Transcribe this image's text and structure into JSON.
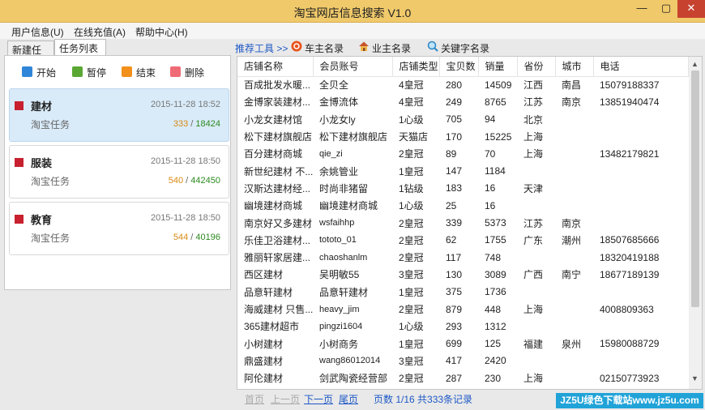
{
  "window": {
    "title": "淘宝网店信息搜索 V1.0",
    "min": "—",
    "max": "▢",
    "close": "✕"
  },
  "menu": [
    "用户信息(U)",
    "在线充值(A)",
    "帮助中心(H)"
  ],
  "left_tabs": [
    "新建任务",
    "任务列表"
  ],
  "actions": [
    {
      "label": "开始",
      "color": "#2f86d9"
    },
    {
      "label": "暂停",
      "color": "#5aa833"
    },
    {
      "label": "结束",
      "color": "#f2901b"
    },
    {
      "label": "删除",
      "color": "#ef6b75"
    }
  ],
  "tasks": [
    {
      "name": "建材",
      "date": "2015-11-28 18:52",
      "type": "淘宝任务",
      "done": "333",
      "total": "18424"
    },
    {
      "name": "服装",
      "date": "2015-11-28 18:50",
      "type": "淘宝任务",
      "done": "540",
      "total": "442450"
    },
    {
      "name": "教育",
      "date": "2015-11-28 18:50",
      "type": "淘宝任务",
      "done": "544",
      "total": "40196"
    }
  ],
  "toolbar": {
    "recommend": "推荐工具 >>",
    "car": "车主名录",
    "business": "业主名录",
    "keyword": "关键字名录"
  },
  "columns": [
    "店铺名称",
    "会员账号",
    "店铺类型",
    "宝贝数",
    "销量",
    "省份",
    "城市",
    "电话"
  ],
  "rows": [
    [
      "百成批发水暖...",
      "全贝全",
      "4皇冠",
      "280",
      "14509",
      "江西",
      "南昌",
      "15079188337"
    ],
    [
      "金博家装建材...",
      "金博流体",
      "4皇冠",
      "249",
      "8765",
      "江苏",
      "南京",
      "13851940474"
    ],
    [
      "小龙女建材馆",
      "小龙女ly",
      "1心级",
      "705",
      "94",
      "北京",
      "",
      ""
    ],
    [
      "松下建材旗舰店",
      "松下建材旗舰店",
      "天猫店",
      "170",
      "15225",
      "上海",
      "",
      ""
    ],
    [
      "百分建材商城",
      "qie_zi",
      "2皇冠",
      "89",
      "70",
      "上海",
      "",
      "13482179821"
    ],
    [
      "新世纪建材 不...",
      "余姚管业",
      "1皇冠",
      "147",
      "1184",
      "",
      "",
      ""
    ],
    [
      "汉斯达建材经...",
      "时尚非猪留",
      "1钻级",
      "183",
      "16",
      "天津",
      "",
      ""
    ],
    [
      "幽境建材商城",
      "幽境建材商城",
      "1心级",
      "25",
      "16",
      "",
      "",
      ""
    ],
    [
      "南京好又多建材",
      "wsfaihhp",
      "2皇冠",
      "339",
      "5373",
      "江苏",
      "南京",
      ""
    ],
    [
      "乐佳卫浴建材...",
      "tototo_01",
      "2皇冠",
      "62",
      "1755",
      "广东",
      "潮州",
      "18507685666"
    ],
    [
      "雅丽轩家居建...",
      "chaoshanlm",
      "2皇冠",
      "117",
      "748",
      "",
      "",
      "18320419188"
    ],
    [
      "西区建材",
      "吴明敏55",
      "3皇冠",
      "130",
      "3089",
      "广西",
      "南宁",
      "18677189139"
    ],
    [
      "品意轩建材",
      "品意轩建材",
      "1皇冠",
      "375",
      "1736",
      "",
      "",
      ""
    ],
    [
      "海威建材 只售...",
      "heavy_jim",
      "2皇冠",
      "879",
      "448",
      "上海",
      "",
      "4008809363"
    ],
    [
      "365建材超市",
      "pingzi1604",
      "1心级",
      "293",
      "1312",
      "",
      "",
      ""
    ],
    [
      "小树建材",
      "小树商务",
      "1皇冠",
      "699",
      "125",
      "福建",
      "泉州",
      "15980088729"
    ],
    [
      "鼎盛建材",
      "wang86012014",
      "3皇冠",
      "417",
      "2420",
      "",
      "",
      ""
    ],
    [
      "阿伦建材",
      "剑武陶瓷经营部",
      "2皇冠",
      "287",
      "230",
      "上海",
      "",
      "02150773923"
    ]
  ],
  "pager": {
    "first": "首页",
    "prev": "上一页",
    "next": "下一页",
    "last": "尾页",
    "info": "页数 1/16 共333条记录"
  },
  "watermark": "JZ5U绿色下载站www.jz5u.com"
}
